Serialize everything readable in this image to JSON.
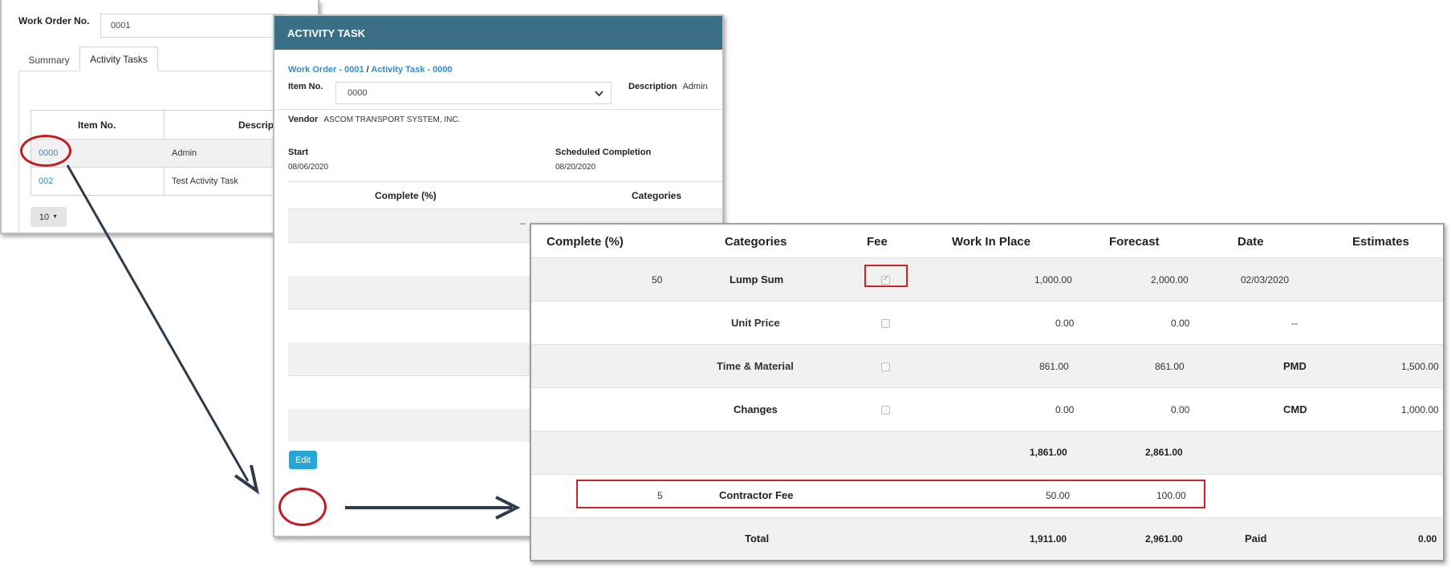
{
  "work_order_window": {
    "label": "Work Order No.",
    "value": "0001",
    "tabs": [
      {
        "label": "Summary"
      },
      {
        "label": "Activity Tasks"
      }
    ],
    "grid": {
      "headers": [
        "Item No.",
        "Descript"
      ],
      "rows": [
        {
          "item": "0000",
          "description": "Admin"
        },
        {
          "item": "002",
          "description": "Test Activity Task"
        }
      ]
    },
    "page_size": "10"
  },
  "activity_window": {
    "title": "ACTIVITY TASK",
    "breadcrumb": {
      "part1": "Work Order - 0001",
      "sep": "/",
      "part2": "Activity Task - 0000"
    },
    "item_label": "Item No.",
    "item_value": "0000",
    "desc_label": "Description",
    "desc_value": "Admin",
    "vendor_label": "Vendor",
    "vendor_value": "ASCOM TRANSPORT SYSTEM, INC.",
    "start_label": "Start",
    "start_value": "08/06/2020",
    "completion_label": "Scheduled Completion",
    "completion_value": "08/20/2020",
    "col_complete": "Complete (%)",
    "col_categories": "Categories",
    "dash": "--",
    "edit_label": "Edit"
  },
  "table_window": {
    "headers": [
      "Complete (%)",
      "Categories",
      "Fee",
      "Work In Place",
      "Forecast",
      "Date",
      "Estimates"
    ],
    "rows": [
      {
        "complete": "50",
        "category": "Lump Sum",
        "category_link": false,
        "fee_checked": true,
        "wip": "1,000.00",
        "forecast": "2,000.00",
        "date": "02/03/2020",
        "estimates": ""
      },
      {
        "complete": "",
        "category": "Unit Price",
        "category_link": true,
        "fee_checked": false,
        "wip": "0.00",
        "forecast": "0.00",
        "date": "--",
        "estimates": ""
      },
      {
        "complete": "",
        "category": "Time & Material",
        "category_link": true,
        "fee_checked": false,
        "wip": "861.00",
        "forecast": "861.00",
        "date": "PMD",
        "estimates": "1,500.00"
      },
      {
        "complete": "",
        "category": "Changes",
        "category_link": false,
        "fee_checked": false,
        "wip": "0.00",
        "forecast": "0.00",
        "date": "CMD",
        "estimates": "1,000.00"
      }
    ],
    "subtotal": {
      "wip": "1,861.00",
      "forecast": "2,861.00"
    },
    "fee_row": {
      "complete": "5",
      "category": "Contractor Fee",
      "wip": "50.00",
      "forecast": "100.00"
    },
    "total_row": {
      "label": "Total",
      "wip": "1,911.00",
      "forecast": "2,961.00",
      "paid_label": "Paid",
      "paid_value": "0.00"
    }
  },
  "colors": {
    "header": "#3b6f86",
    "link": "#2f8ec9",
    "highlight": "#d21f2a",
    "arrow": "#2e3b4e",
    "button": "#2aa5d3"
  }
}
